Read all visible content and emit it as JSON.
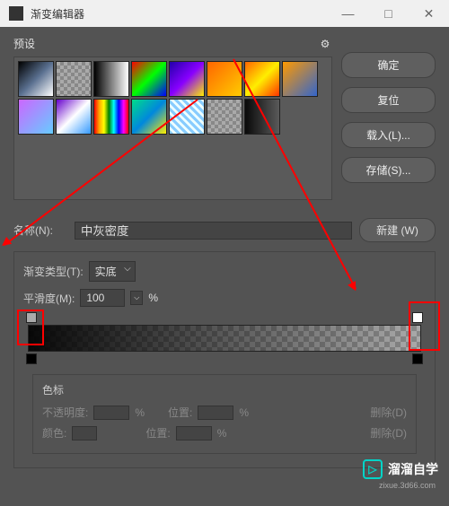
{
  "titlebar": {
    "title": "渐变编辑器"
  },
  "presets": {
    "label": "预设",
    "swatches": [
      {
        "bg": "linear-gradient(135deg,#000,#5a7090,#fff)"
      },
      {
        "bg": "repeating-conic-gradient(#888 0% 25%, #aaa 0% 50%) 0 0/8px 8px"
      },
      {
        "bg": "linear-gradient(to right,#000,#fff)"
      },
      {
        "bg": "linear-gradient(135deg,#ff0000,#00ff00,#0000ff)"
      },
      {
        "bg": "linear-gradient(135deg,#2200aa,#8800ff,#ffee00)"
      },
      {
        "bg": "linear-gradient(135deg,#ff6600,#ffcc00)"
      },
      {
        "bg": "linear-gradient(135deg,#ff6600,#ffee00,#ff3300)"
      },
      {
        "bg": "linear-gradient(135deg,#ff9900,#3366cc)"
      },
      {
        "bg": "linear-gradient(135deg,#cc66ff,#66ccff)"
      },
      {
        "bg": "linear-gradient(135deg,#6600cc,#ffffff,#3399ff)"
      },
      {
        "bg": "linear-gradient(to right,red,orange,yellow,green,cyan,blue,magenta,red)"
      },
      {
        "bg": "linear-gradient(135deg,#00dd88,#0088dd,#ffee00)"
      },
      {
        "bg": "repeating-linear-gradient(45deg,#88ccff,#88ccff 3px,#eeffff 3px,#eeffff 6px)"
      },
      {
        "bg": "repeating-conic-gradient(#888 0% 25%, #aaa 0% 50%) 0 0/8px 8px"
      },
      {
        "bg": "linear-gradient(to right,rgba(0,0,0,0.9),rgba(0,0,0,0))"
      }
    ]
  },
  "buttons": {
    "ok": "确定",
    "reset": "复位",
    "load": "载入(L)...",
    "save": "存储(S)...",
    "new": "新建 (W)"
  },
  "name": {
    "label": "名称(N):",
    "value": "中灰密度"
  },
  "gradient": {
    "type_label": "渐变类型(T):",
    "type_value": "实底",
    "smooth_label": "平滑度(M):",
    "smooth_value": "100",
    "smooth_unit": "%"
  },
  "stops": {
    "title": "色标",
    "opacity_label": "不透明度:",
    "opacity_unit": "%",
    "position_label": "位置:",
    "position_unit": "%",
    "delete_label": "删除(D)",
    "color_label": "颜色:"
  },
  "watermark": {
    "text": "溜溜自学",
    "sub": "zixue.3d66.com"
  }
}
